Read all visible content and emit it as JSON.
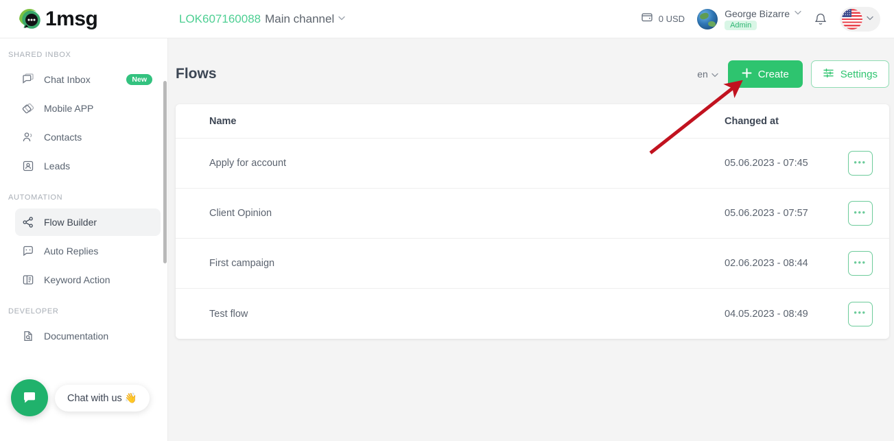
{
  "brand": {
    "name": "1msg",
    "logo_icon": "1msg-logo-icon"
  },
  "topbar": {
    "channel": {
      "id": "LOK607160088",
      "name": "Main channel",
      "chevron": "⌄"
    },
    "wallet": {
      "icon": "wallet-icon",
      "amount": "0 USD"
    },
    "user": {
      "name": "George Bizarre",
      "role": "Admin",
      "avatar_icon": "earth-avatar",
      "chevron": "⌄"
    },
    "notifications_icon": "bell-icon",
    "language": {
      "flag_icon": "us-flag-icon",
      "chevron": "⌄"
    }
  },
  "sidebar": {
    "sections": [
      {
        "label": "SHARED INBOX",
        "items": [
          {
            "label": "Chat Inbox",
            "icon": "chat-bubble-icon",
            "badge": "New",
            "active": false
          },
          {
            "label": "Mobile APP",
            "icon": "mobile-app-icon",
            "badge": "",
            "active": false
          },
          {
            "label": "Contacts",
            "icon": "contacts-icon",
            "badge": "",
            "active": false
          },
          {
            "label": "Leads",
            "icon": "leads-icon",
            "badge": "",
            "active": false
          }
        ]
      },
      {
        "label": "AUTOMATION",
        "items": [
          {
            "label": "Flow Builder",
            "icon": "share-nodes-icon",
            "badge": "",
            "active": true
          },
          {
            "label": "Auto Replies",
            "icon": "auto-replies-icon",
            "badge": "",
            "active": false
          },
          {
            "label": "Keyword Action",
            "icon": "keyword-icon",
            "badge": "",
            "active": false
          }
        ]
      },
      {
        "label": "DEVELOPER",
        "items": [
          {
            "label": "Documentation",
            "icon": "document-search-icon",
            "badge": "",
            "active": false
          }
        ]
      }
    ]
  },
  "chat_widget": {
    "fab_icon": "chat-icon",
    "label": "Chat with us 👋"
  },
  "main": {
    "title": "Flows",
    "language_selector": {
      "value": "en",
      "chevron": "⌄"
    },
    "create_button": {
      "label": "Create",
      "icon": "plus-icon"
    },
    "settings_button": {
      "label": "Settings",
      "icon": "sliders-icon"
    },
    "table": {
      "columns": [
        "Name",
        "Changed at",
        ""
      ],
      "rows": [
        {
          "name": "Apply for account",
          "changed_at": "05.06.2023 - 07:45",
          "actions": "•••"
        },
        {
          "name": "Client Opinion",
          "changed_at": "05.06.2023 - 07:57",
          "actions": "•••"
        },
        {
          "name": "First campaign",
          "changed_at": "02.06.2023 - 08:44",
          "actions": "•••"
        },
        {
          "name": "Test flow",
          "changed_at": "04.05.2023 - 08:49",
          "actions": "•••"
        }
      ]
    }
  },
  "annotation": {
    "type": "arrow",
    "color": "#c1121f",
    "points_to": "create-button"
  },
  "colors": {
    "brand_green": "#2ec46f",
    "accent_green_light": "#4ecf93",
    "text_dark": "#3c4654",
    "text_muted": "#5b636f",
    "page_bg": "#f4f4f4",
    "annotation_red": "#c1121f"
  }
}
